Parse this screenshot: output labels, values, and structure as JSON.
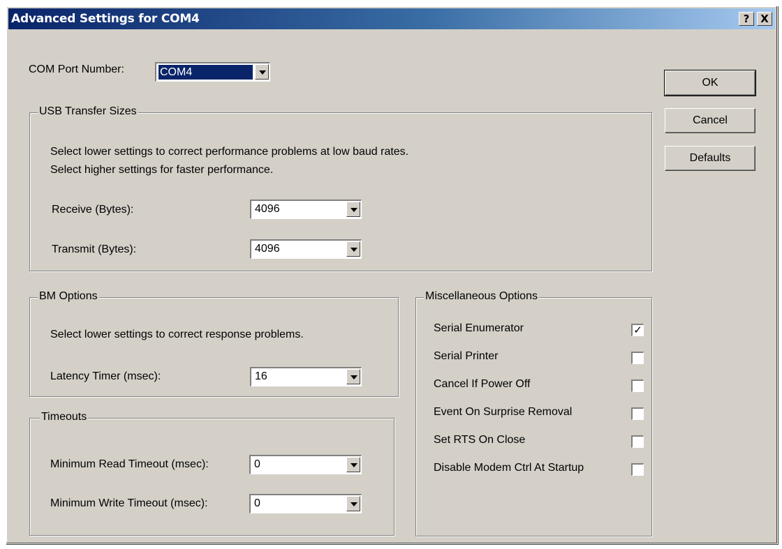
{
  "window": {
    "title": "Advanced Settings for COM4",
    "help_glyph": "?",
    "close_glyph": "X"
  },
  "com_port": {
    "label": "COM Port Number:",
    "value": "COM4"
  },
  "usb": {
    "legend": "USB Transfer Sizes",
    "desc1": "Select lower settings to correct performance problems at low baud rates.",
    "desc2": "Select higher settings for faster performance.",
    "receive_label": "Receive (Bytes):",
    "receive_value": "4096",
    "transmit_label": "Transmit (Bytes):",
    "transmit_value": "4096"
  },
  "bm": {
    "legend": "BM Options",
    "desc": "Select lower settings to correct response problems.",
    "latency_label": "Latency Timer (msec):",
    "latency_value": "16"
  },
  "timeouts": {
    "legend": "Timeouts",
    "read_label": "Minimum Read Timeout (msec):",
    "read_value": "0",
    "write_label": "Minimum Write Timeout (msec):",
    "write_value": "0"
  },
  "misc": {
    "legend": "Miscellaneous Options",
    "options": [
      {
        "label": "Serial Enumerator",
        "checked": true
      },
      {
        "label": "Serial Printer",
        "checked": false
      },
      {
        "label": "Cancel If Power Off",
        "checked": false
      },
      {
        "label": "Event On Surprise Removal",
        "checked": false
      },
      {
        "label": "Set RTS On Close",
        "checked": false
      },
      {
        "label": "Disable Modem Ctrl At Startup",
        "checked": false
      }
    ]
  },
  "buttons": {
    "ok": "OK",
    "cancel": "Cancel",
    "defaults": "Defaults"
  },
  "colors": {
    "face": "#d4d0c8",
    "title_start": "#0a246a",
    "title_end": "#a6caf0",
    "selection": "#0a246a"
  }
}
